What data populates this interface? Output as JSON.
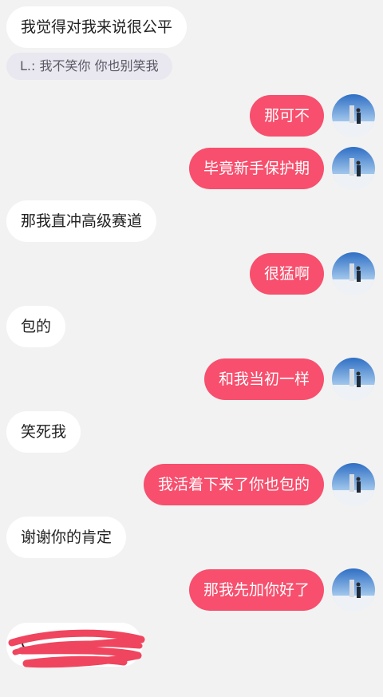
{
  "messages": [
    {
      "text": "我觉得对我来说很公平"
    },
    {
      "text": "那可不"
    },
    {
      "text": "毕竟新手保护期"
    },
    {
      "text": "那我直冲高级赛道"
    },
    {
      "text": "很猛啊"
    },
    {
      "text": "包的"
    },
    {
      "text": "和我当初一样"
    },
    {
      "text": "笑死我"
    },
    {
      "text": "我活着下来了你也包的"
    },
    {
      "text": "谢谢你的肯定"
    },
    {
      "text": "那我先加你好了"
    },
    {
      "text": "C"
    }
  ],
  "quote": {
    "text": "L.: 我不笑你 你也别笑我"
  },
  "colors": {
    "background": "#f2f2f2",
    "incoming_bubble": "#ffffff",
    "outgoing_bubble": "#f74f6d",
    "quote_bg": "#e9e8f0",
    "scribble": "#f0455e"
  },
  "icons": {
    "avatar": "user-avatar",
    "redaction": "red-scribble-redaction"
  }
}
